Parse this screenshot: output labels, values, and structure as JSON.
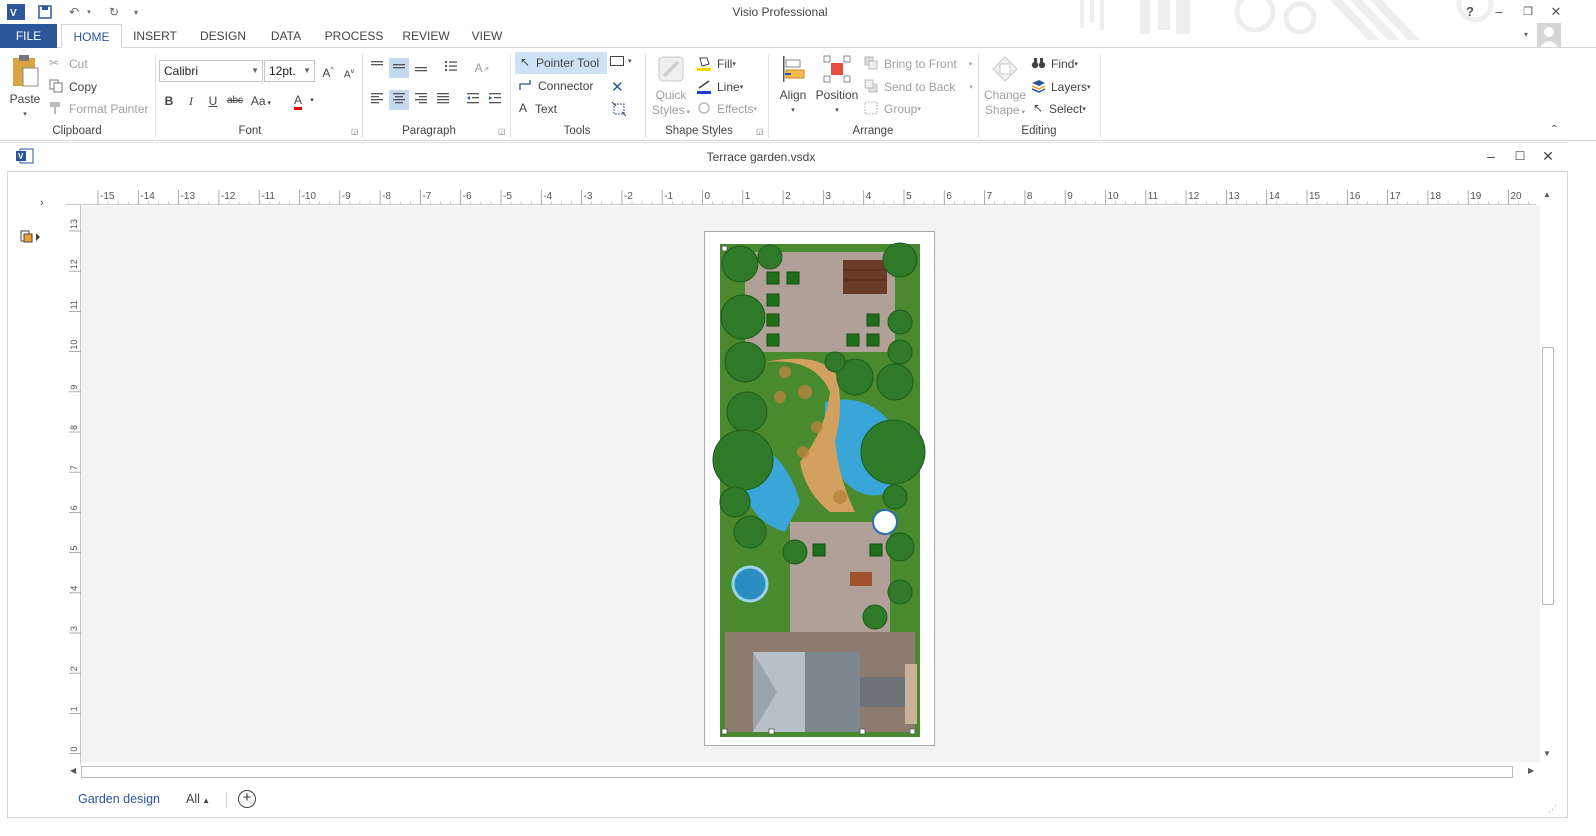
{
  "app": {
    "title": "Visio Professional",
    "document_title": "Terrace garden.vsdx"
  },
  "tabs": [
    {
      "label": "FILE"
    },
    {
      "label": "HOME"
    },
    {
      "label": "INSERT"
    },
    {
      "label": "DESIGN"
    },
    {
      "label": "DATA"
    },
    {
      "label": "PROCESS"
    },
    {
      "label": "REVIEW"
    },
    {
      "label": "VIEW"
    }
  ],
  "active_tab": "HOME",
  "clipboard": {
    "paste": "Paste",
    "cut": "Cut",
    "copy": "Copy",
    "format_painter": "Format Painter",
    "label": "Clipboard"
  },
  "font": {
    "family": "Calibri",
    "size": "12pt.",
    "label": "Font",
    "bold": "B",
    "italic": "I",
    "underline": "U",
    "strike": "abc",
    "case": "Aa",
    "color_letter": "A"
  },
  "paragraph": {
    "label": "Paragraph"
  },
  "tools": {
    "pointer": "Pointer Tool",
    "connector": "Connector",
    "text": "Text",
    "label": "Tools"
  },
  "shape_styles": {
    "quick_styles_1": "Quick",
    "quick_styles_2": "Styles",
    "fill": "Fill",
    "line": "Line",
    "effects": "Effects",
    "label": "Shape Styles"
  },
  "arrange": {
    "align": "Align",
    "position": "Position",
    "bring_front": "Bring to Front",
    "send_back": "Send to Back",
    "group": "Group",
    "label": "Arrange"
  },
  "editing": {
    "change_shape_1": "Change",
    "change_shape_2": "Shape",
    "find": "Find",
    "layers": "Layers",
    "select": "Select",
    "label": "Editing"
  },
  "ruler": {
    "h_ticks": [
      "-15",
      "-14",
      "-13",
      "-12",
      "-11",
      "-10",
      "-9",
      "-8",
      "-7",
      "-6",
      "-5",
      "-4",
      "-3",
      "-2",
      "-1",
      "0",
      "1",
      "2",
      "3",
      "4",
      "5",
      "6",
      "7",
      "8",
      "9",
      "10",
      "11",
      "12",
      "13",
      "14",
      "15",
      "16",
      "17",
      "18",
      "19",
      "20"
    ],
    "v_ticks": [
      "13",
      "12",
      "11",
      "10",
      "9",
      "8",
      "7",
      "6",
      "5",
      "4",
      "3",
      "2",
      "1",
      "0"
    ]
  },
  "page_tabs": {
    "current": "Garden design",
    "all": "All"
  },
  "colors": {
    "accent": "#2b579a",
    "grass": "#4a8a2e",
    "paving": "#a89a90",
    "water": "#3aa6d8",
    "stone": "#d4a060",
    "roof": "#9aa4ad"
  }
}
